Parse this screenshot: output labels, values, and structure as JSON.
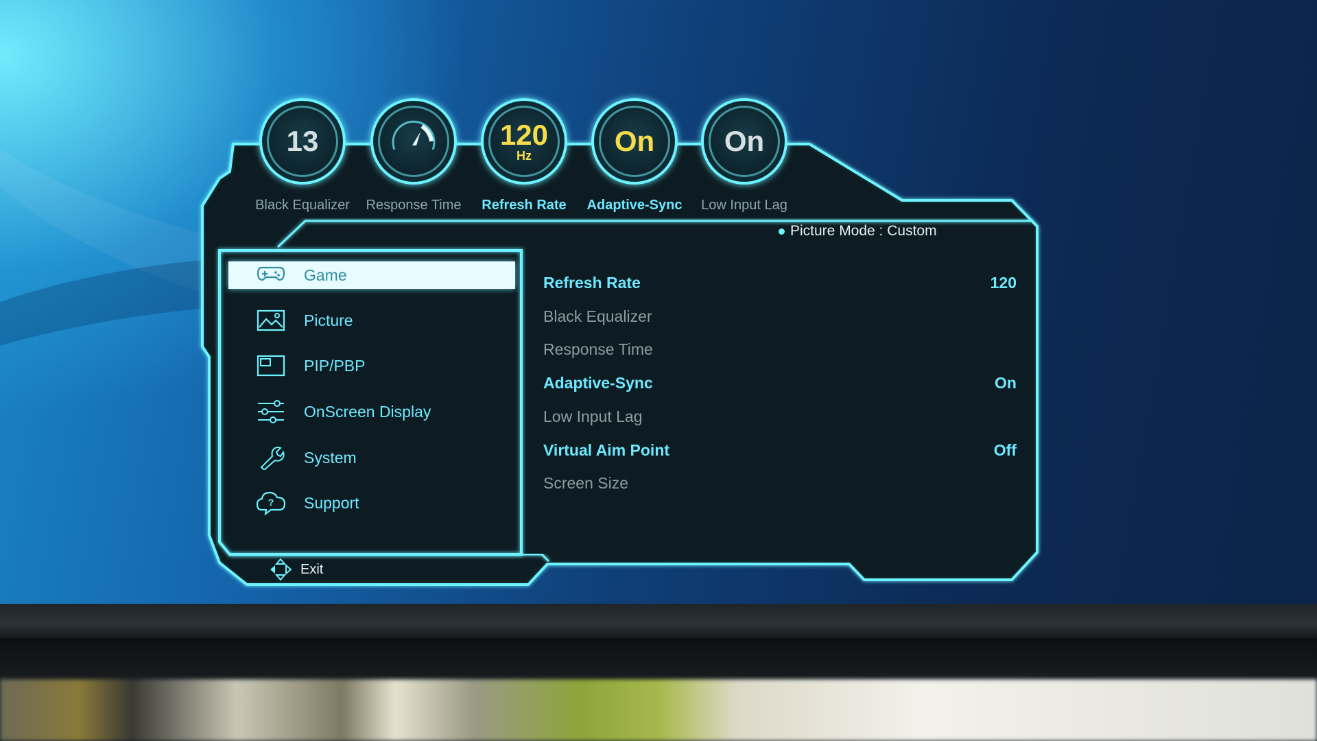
{
  "badges": [
    {
      "value": "13",
      "unit": "",
      "label": "Black Equalizer",
      "active": false,
      "kind": "number"
    },
    {
      "value": "",
      "unit": "",
      "label": "Response Time",
      "active": false,
      "kind": "gauge"
    },
    {
      "value": "120",
      "unit": "Hz",
      "label": "Refresh Rate",
      "active": true,
      "kind": "number"
    },
    {
      "value": "On",
      "unit": "",
      "label": "Adaptive-Sync",
      "active": true,
      "kind": "number"
    },
    {
      "value": "On",
      "unit": "",
      "label": "Low Input Lag",
      "active": false,
      "kind": "number"
    }
  ],
  "picture_mode": {
    "label": "Picture Mode :",
    "value": "Custom"
  },
  "menu": [
    {
      "label": "Game",
      "icon": "gamepad-icon",
      "selected": true
    },
    {
      "label": "Picture",
      "icon": "picture-icon",
      "selected": false
    },
    {
      "label": "PIP/PBP",
      "icon": "pip-icon",
      "selected": false
    },
    {
      "label": "OnScreen Display",
      "icon": "sliders-icon",
      "selected": false
    },
    {
      "label": "System",
      "icon": "wrench-icon",
      "selected": false
    },
    {
      "label": "Support",
      "icon": "support-icon",
      "selected": false
    }
  ],
  "settings": [
    {
      "label": "Refresh Rate",
      "value": "120",
      "enabled": true
    },
    {
      "label": "Black Equalizer",
      "value": "",
      "enabled": false
    },
    {
      "label": "Response Time",
      "value": "",
      "enabled": false
    },
    {
      "label": "Adaptive-Sync",
      "value": "On",
      "enabled": true
    },
    {
      "label": "Low Input Lag",
      "value": "",
      "enabled": false
    },
    {
      "label": "Virtual Aim Point",
      "value": "Off",
      "enabled": true
    },
    {
      "label": "Screen Size",
      "value": "",
      "enabled": false
    }
  ],
  "exit_label": "Exit",
  "colors": {
    "accent": "#6df2ff",
    "highlight": "#f7dc4a",
    "panel": "#0c1a1f"
  }
}
